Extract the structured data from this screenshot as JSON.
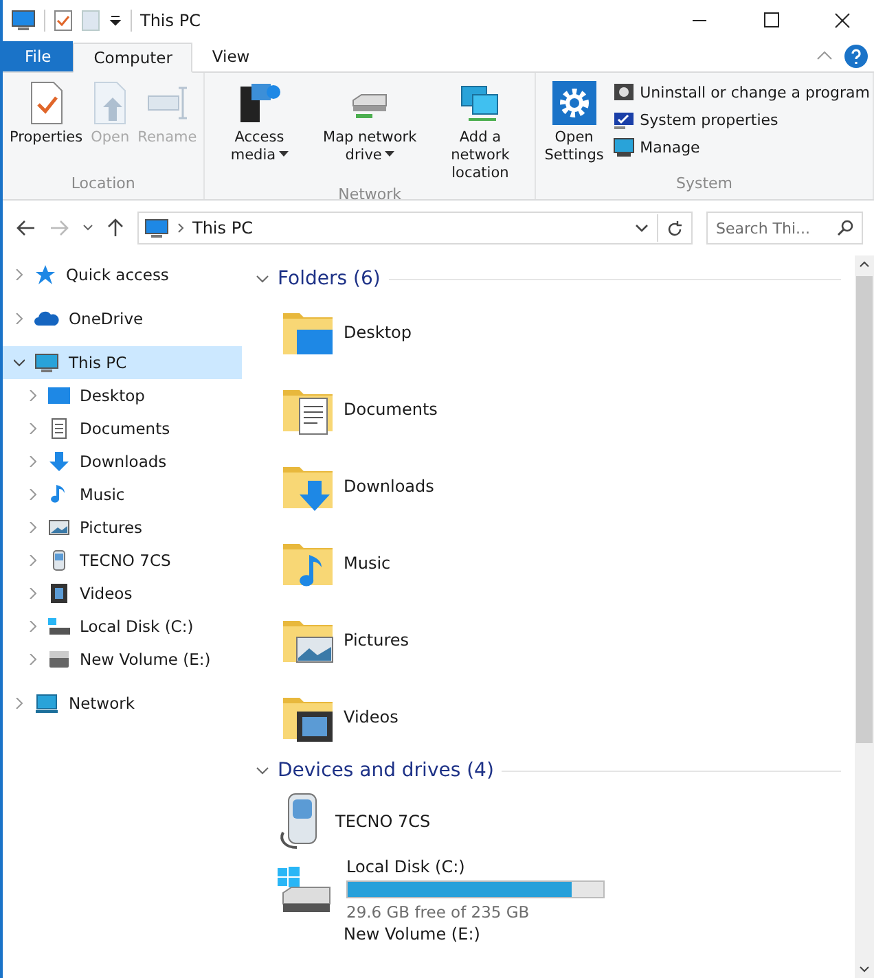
{
  "window": {
    "title": "This PC"
  },
  "ribbon_tabs": [
    {
      "label": "File",
      "kind": "file"
    },
    {
      "label": "Computer",
      "kind": "tab",
      "selected": true
    },
    {
      "label": "View",
      "kind": "tab",
      "selected": false
    }
  ],
  "ribbon_groups": [
    {
      "name": "Location",
      "buttons": [
        {
          "label": "Properties",
          "disabled": false,
          "has_menu": false
        },
        {
          "label": "Open",
          "disabled": true,
          "has_menu": false
        },
        {
          "label": "Rename",
          "disabled": true,
          "has_menu": false
        }
      ]
    },
    {
      "name": "Network",
      "buttons": [
        {
          "label": "Access media",
          "disabled": false,
          "has_menu": true
        },
        {
          "label": "Map network drive",
          "disabled": false,
          "has_menu": true
        },
        {
          "label": "Add a network location",
          "disabled": false,
          "has_menu": false
        }
      ]
    },
    {
      "name": "System",
      "buttons": [
        {
          "label": "Open Settings",
          "disabled": false,
          "has_menu": false
        }
      ],
      "links": [
        "Uninstall or change a program",
        "System properties",
        "Manage"
      ]
    }
  ],
  "address_bar": {
    "path": "This PC",
    "search_placeholder": "Search Thi..."
  },
  "sidebar": {
    "items": [
      {
        "label": "Quick access",
        "selected": false,
        "expanded": false
      },
      {
        "label": "OneDrive",
        "selected": false,
        "expanded": false
      },
      {
        "label": "This PC",
        "selected": true,
        "expanded": true,
        "children": [
          {
            "label": "Desktop"
          },
          {
            "label": "Documents"
          },
          {
            "label": "Downloads"
          },
          {
            "label": "Music"
          },
          {
            "label": "Pictures"
          },
          {
            "label": "TECNO 7CS"
          },
          {
            "label": "Videos"
          },
          {
            "label": "Local Disk (C:)"
          },
          {
            "label": "New Volume (E:)"
          }
        ]
      },
      {
        "label": "Network",
        "selected": false,
        "expanded": false
      }
    ]
  },
  "folders": {
    "title": "Folders (6)",
    "items": [
      "Desktop",
      "Documents",
      "Downloads",
      "Music",
      "Pictures",
      "Videos"
    ]
  },
  "devices": {
    "title": "Devices and drives (4)",
    "items": [
      {
        "name": "TECNO 7CS",
        "kind": "device"
      },
      {
        "name": "Local Disk (C:)",
        "kind": "drive",
        "level": 0.874,
        "free": "29.6 GB free of 235 GB"
      },
      {
        "name": "New Volume (E:)",
        "kind": "label"
      }
    ]
  }
}
